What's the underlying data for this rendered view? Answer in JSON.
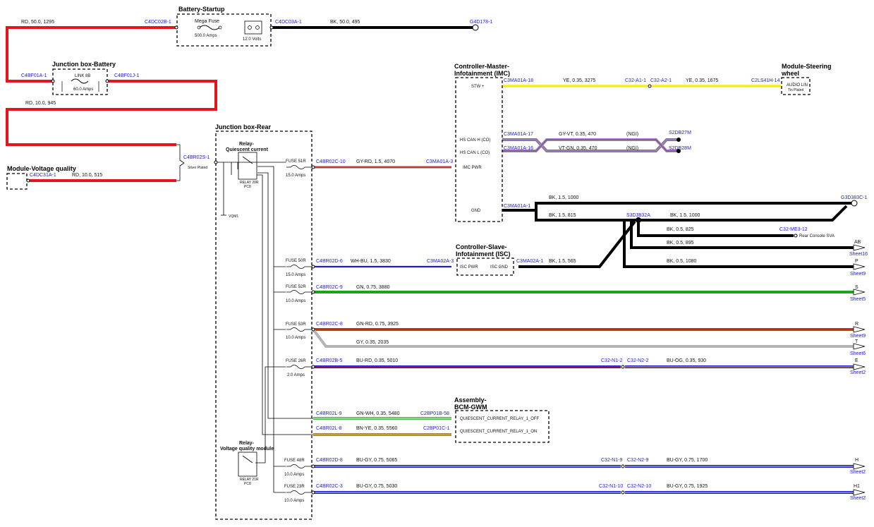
{
  "modules": {
    "battery_startup": "Battery-Startup",
    "junction_battery": "Junction box-Battery",
    "voltage_quality": "Module-Voltage quality",
    "junction_rear": "Junction box-Rear",
    "imc_l1": "Controller-Master-",
    "imc_l2": "Infotainment (IMC)",
    "steering_l1": "Module-Steering",
    "steering_l2": "wheel",
    "isc_l1": "Controller-Slave-",
    "isc_l2": "Infotainment (ISC)",
    "bcm_l1": "Assembly-",
    "bcm_l2": "BCM-GWM",
    "relay_qc_l1": "Relay-",
    "relay_qc_l2": "Quiescent current",
    "relay_vq_l1": "Relay-",
    "relay_vq_l2": "Voltage quality module"
  },
  "components": {
    "mega_fuse": "Mega Fuse",
    "mega_amps": "500.0 Amps",
    "battery_volts": "12.0 Volts",
    "link": "LINK 8B",
    "link_amps": "60.0 Amps",
    "silver": "Silver Plated",
    "relay20": "RELAY 20R",
    "pc8": "PC8",
    "relay21": "RELAY 21R",
    "pc8b": "PC8",
    "vqm": "VQM1",
    "audio_lin": "AUDIO LIN",
    "tin_plated": "Tin Plated",
    "rear_console": "Rear Console SVA"
  },
  "pins": {
    "stw": "STW +",
    "can_h": "HS CAN H (CO)",
    "can_l": "HS CAN L (CO)",
    "imc_pwr": "IMC PWR",
    "gnd": "GND",
    "isc_pwr": "ISC PWR",
    "isc_gnd": "ISC GND",
    "qc_off": "QUIESCENT_CURRENT_RELAY_1_OFF",
    "qc_on": "QUIESCENT_CURRENT_RELAY_1_ON"
  },
  "fuses": [
    {
      "name": "FUSE 51R",
      "amps": "15.0 Amps"
    },
    {
      "name": "FUSE 50R",
      "amps": "15.0 Amps"
    },
    {
      "name": "FUSE 52R",
      "amps": "10.0 Amps"
    },
    {
      "name": "FUSE 53R",
      "amps": "10.0 Amps"
    },
    {
      "name": "FUSE 26R",
      "amps": "2.0 Amps"
    },
    {
      "name": "FUSE 48R",
      "amps": "10.0 Amps"
    },
    {
      "name": "FUSE 23R",
      "amps": "10.0 Amps"
    }
  ],
  "connectors": {
    "c4dc02b": "C4DC02B-1",
    "c4dc03a": "C4DC03A-1",
    "g4d178": "G4D178-1",
    "c4bf01a": "C4BF01A-1",
    "c4bf01j": "C4BF01J-1",
    "c4br02s": "C4BR02S-1",
    "c4dc31a": "C4DC31A-1",
    "c3ma01a18": "C3MA01A-18",
    "c32a11": "C32-A1-1",
    "c32a21": "C32-A2-1",
    "c2ls41h": "C2LS41H-14",
    "c3ma01a17": "C3MA01A-17",
    "c3ma01a16": "C3MA01A-16",
    "s2db27m": "S2DB27M",
    "s2db28m": "S2DB28M",
    "c4br02c10": "C4BR02C-10",
    "c3ma01a3": "C3MA01A-3",
    "c3ma01a1": "C3MA01A-1",
    "g3d383c": "G3D383C-1",
    "s3d3832a": "S3D3832A",
    "c32me312": "C32-ME3-12",
    "c4br02d6": "C4BR02D-6",
    "c3ma02a3": "C3MA02A-3",
    "c3ma02a1": "C3MA02A-1",
    "c4br02c9": "C4BR02C-9",
    "c4br02c8": "C4BR02C-8",
    "c4br02b5": "C4BR02B-5",
    "c32n12": "C32-N1-2",
    "c32n22": "C32-N2-2",
    "c4br02l9": "C4BR02L-9",
    "c2bp01b58": "C2BP01B-58",
    "c4br02l8": "C4BR02L-8",
    "c2bp01c1": "C2BP01C-1",
    "c4br02d8": "C4BR02D-8",
    "c32n19": "C32-N1-9",
    "c32n29": "C32-N2-9",
    "c4br02c3": "C4BR02C-3",
    "c32n110": "C32-N1-10",
    "c32n210": "C32-N2-10"
  },
  "wires": {
    "rd_50": "RD, 50.0, 1295",
    "bk_50": "BK, 50.0, 495",
    "rd_10_945": "RD, 10.0, 945",
    "rd_10_515": "RD, 10.0, 515",
    "ye_3275": "YE, 0.35, 3275",
    "ye_1675": "YE, 0.35, 1675",
    "gyvt": "GY-VT, 0.35, 470",
    "vtgn": "VT-GN, 0.35, 470",
    "ngi1": "(NGI)",
    "ngi2": "(NGI)",
    "gyrd": "GY-RD, 1.5, 4070",
    "bk_1000a": "BK, 1.5, 1000",
    "bk_815": "BK, 1.5, 815",
    "bk_1000b": "BK, 1.5, 1000",
    "bk_825": "BK, 0.5, 825",
    "bk_895": "BK, 0.5, 895",
    "whbu": "WH-BU, 1.5, 3830",
    "bk_565": "BK, 1.5, 565",
    "bk_1080": "BK, 0.5, 1080",
    "gn": "GN, 0.75, 3880",
    "gnrd": "GN-RD, 0.75, 3925",
    "gy": "GY, 0.35, 2035",
    "burd": "BU-RD, 0.35, 5010",
    "buog": "BU-OG, 0.35, 930",
    "gnwh": "GN-WH, 0.35, 5480",
    "bnye": "BN-YE, 0.35, 5560",
    "bugy5065": "BU-GY, 0.75, 5065",
    "bugy1700": "BU-GY, 0.75, 1700",
    "bugy5030": "BU-GY, 0.75, 5030",
    "bugy1925": "BU-GY, 0.75, 1925"
  },
  "sheet_refs": [
    {
      "letter": "AB",
      "sheet": "Sheet16"
    },
    {
      "letter": "P",
      "sheet": "Sheet9"
    },
    {
      "letter": "S",
      "sheet": "Sheet5"
    },
    {
      "letter": "R",
      "sheet": "Sheet9"
    },
    {
      "letter": "T",
      "sheet": "Sheet6"
    },
    {
      "letter": "E",
      "sheet": "Sheet2"
    },
    {
      "letter": "H",
      "sheet": "Sheet2"
    },
    {
      "letter": "H1",
      "sheet": "Sheet2"
    }
  ],
  "colors": {
    "red": "#e8141c",
    "black": "#000000",
    "yellow": "#f5ee1c",
    "violet": "#b07ad8",
    "green": "#1aa41a",
    "brown": "#8a5a1c",
    "grey": "#b4b4b4",
    "blue": "#1c1ccc",
    "orange": "#f0a020",
    "connector": "#1a1adc"
  }
}
